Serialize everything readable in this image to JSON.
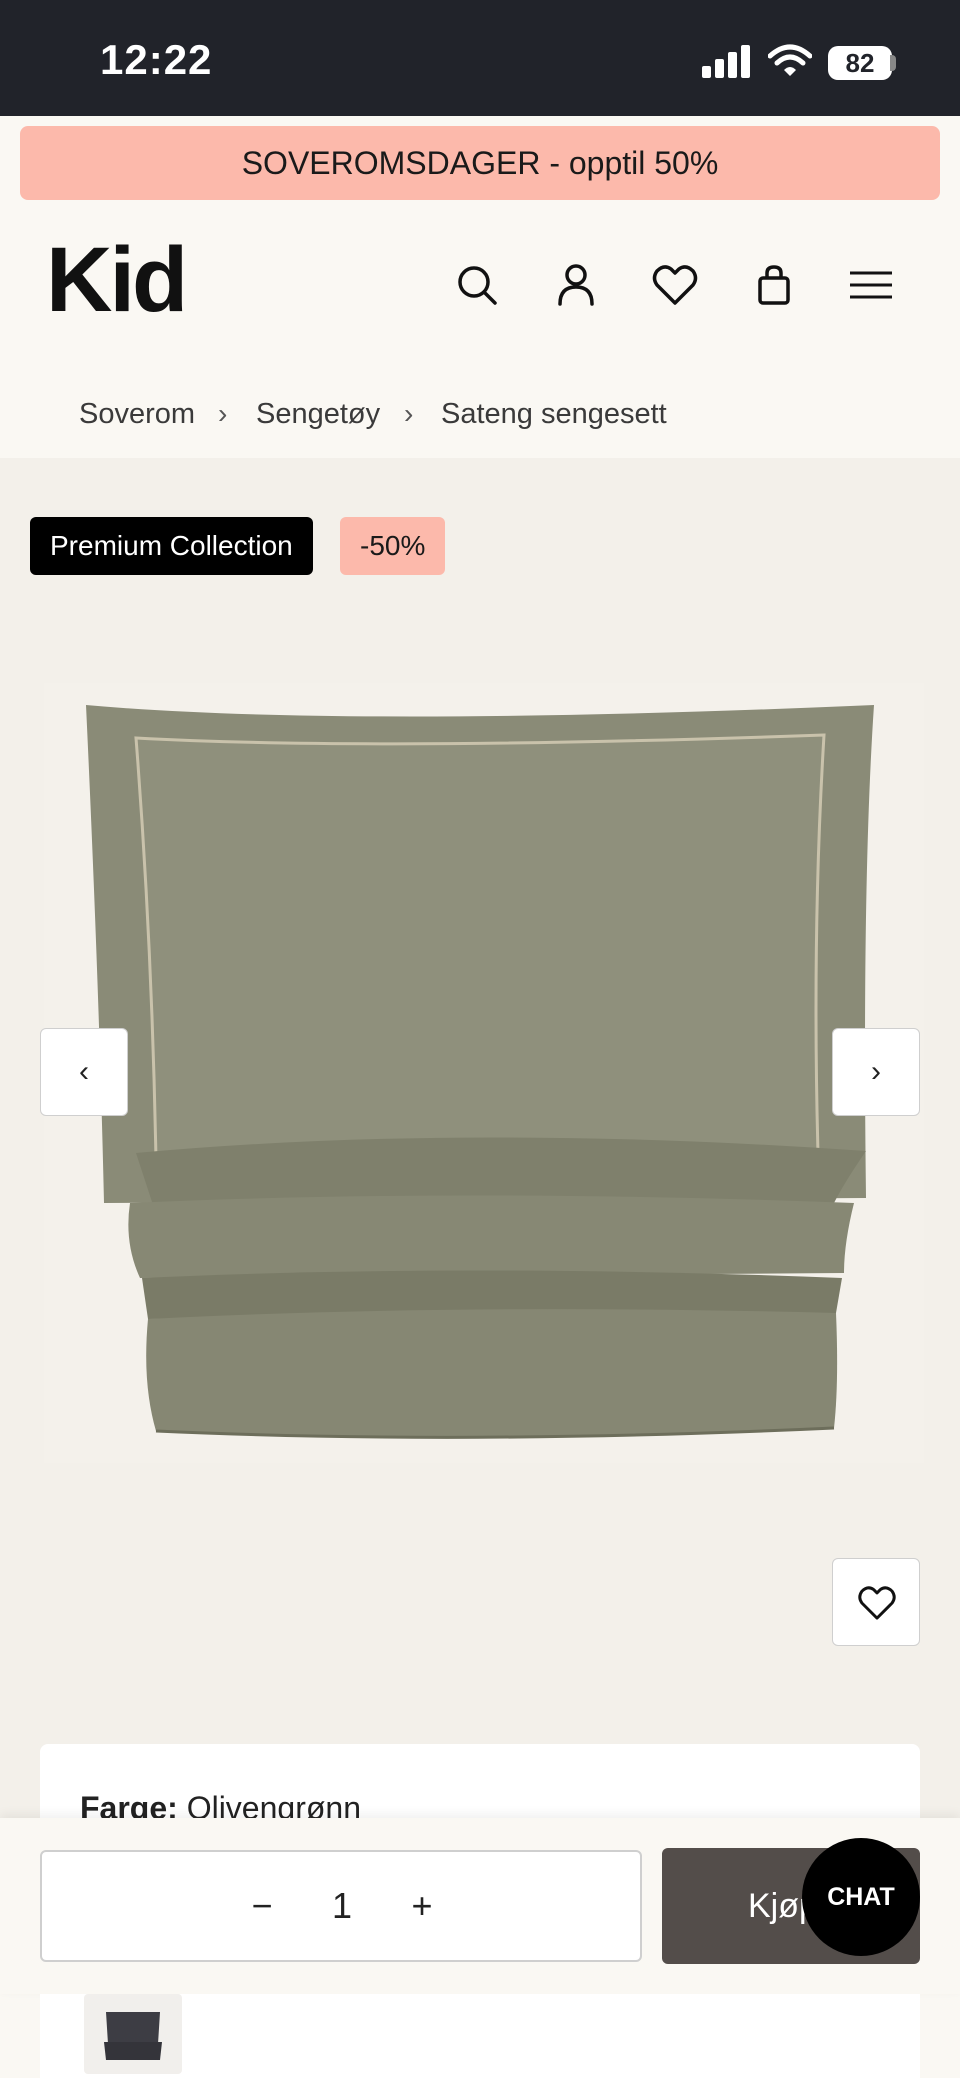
{
  "status_bar": {
    "time": "12:22",
    "battery": "82"
  },
  "promo": {
    "text": "SOVEROMSDAGER - opptil 50%"
  },
  "header": {
    "logo": "Kid",
    "icons": [
      "search-icon",
      "account-icon",
      "heart-icon",
      "bag-icon",
      "menu-icon"
    ]
  },
  "breadcrumb": {
    "items": [
      "Soverom",
      "Sengetøy",
      "Sateng sengesett"
    ],
    "separator": "›"
  },
  "product": {
    "badges": {
      "collection": "Premium Collection",
      "discount": "-50%"
    },
    "image_alt_color": "#8b8c78",
    "nav_prev": "‹",
    "nav_next": "›",
    "color_label": "Farge:",
    "color_value": "Olivengrønn"
  },
  "buy_bar": {
    "qty_minus": "−",
    "qty_value": "1",
    "qty_plus": "+",
    "buy_label": "Kjøp"
  },
  "chat": {
    "label": "CHAT"
  },
  "colors": {
    "promo_bg": "#fcb9ab",
    "buy_button": "#534d4a",
    "status_bar": "#21232a"
  }
}
